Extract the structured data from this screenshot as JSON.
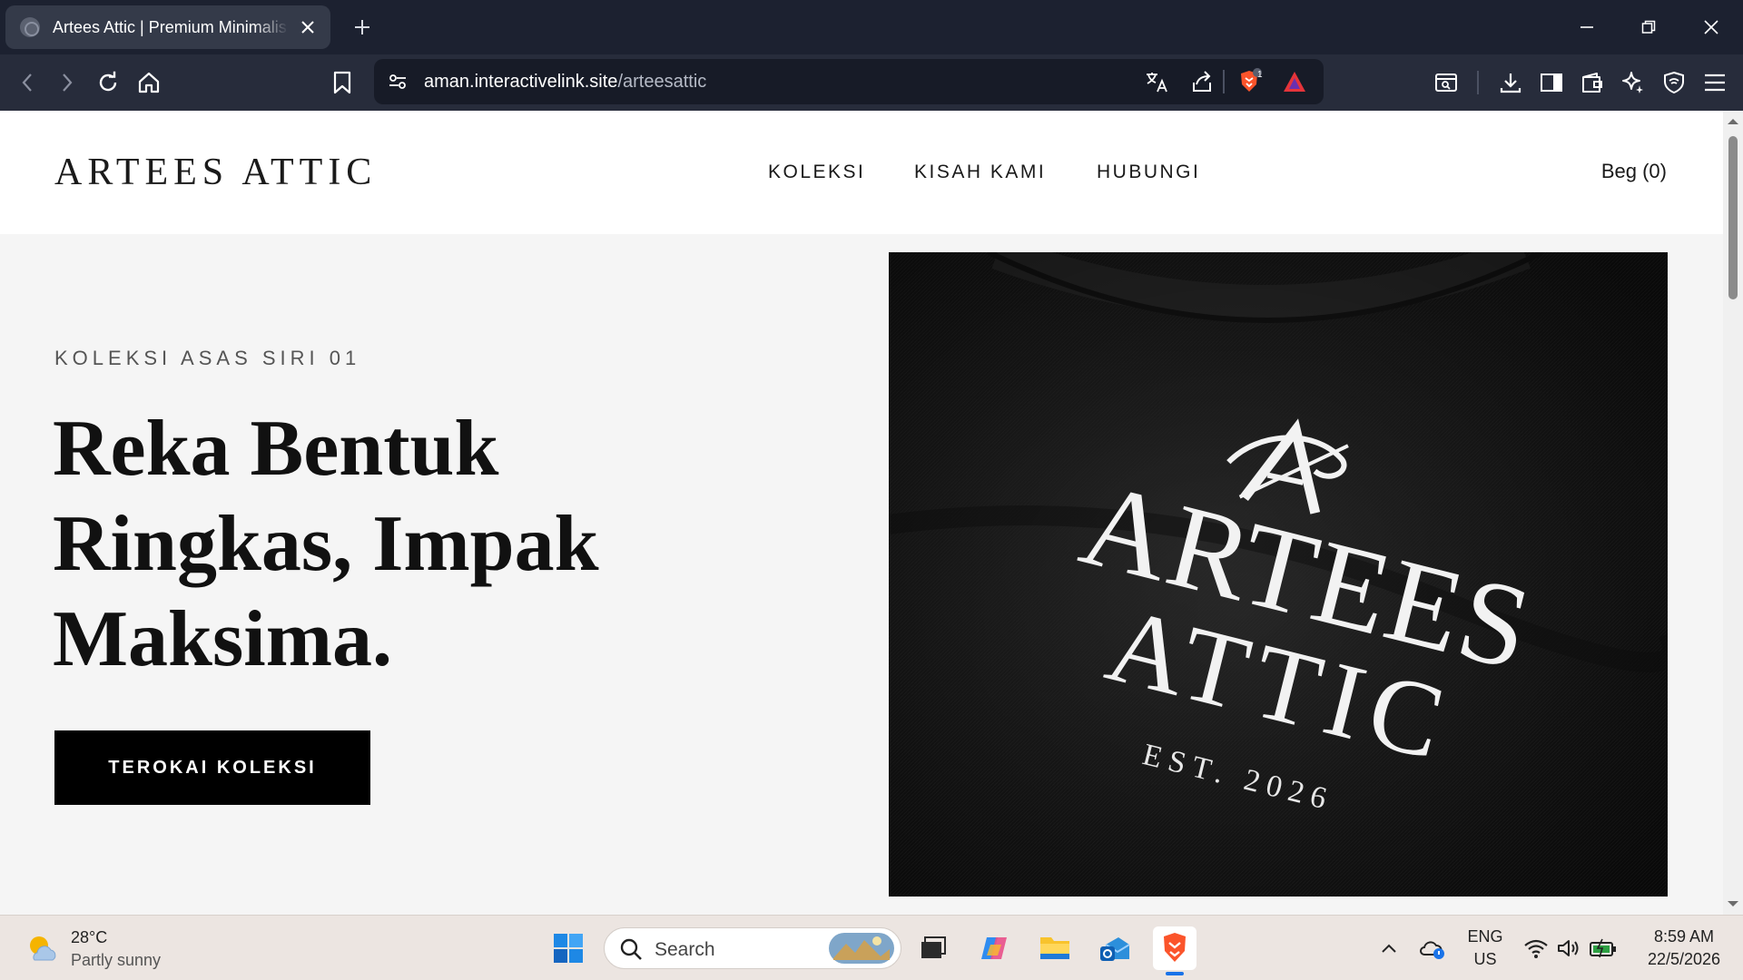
{
  "browser": {
    "tab_title": "Artees Attic | Premium Minimalis",
    "url_domain": "aman.interactivelink.site",
    "url_path": "/arteesattic",
    "shields_count": "1"
  },
  "site": {
    "logo": "ARTEES ATTIC",
    "nav": [
      "KOLEKSI",
      "KISAH KAMI",
      "HUBUNGI"
    ],
    "bag_label": "Beg (0)",
    "eyebrow": "KOLEKSI ASAS SIRI 01",
    "headline": "Reka Bentuk Ringkas, Impak Maksima.",
    "cta_label": "TEROKAI KOLEKSI",
    "hero_image": {
      "brand_line1": "ARTEES",
      "brand_line2": "ATTIC",
      "established": "EST. 2026"
    }
  },
  "taskbar": {
    "temperature": "28°C",
    "weather": "Partly sunny",
    "search_placeholder": "Search",
    "language": "ENG",
    "region": "US",
    "time": "8:59 AM",
    "date": "22/5/2026"
  },
  "colors": {
    "chrome_dark": "#1c2130",
    "page_bg": "#f5f5f5",
    "cta_bg": "#000000",
    "brave_orange": "#fb542b"
  }
}
